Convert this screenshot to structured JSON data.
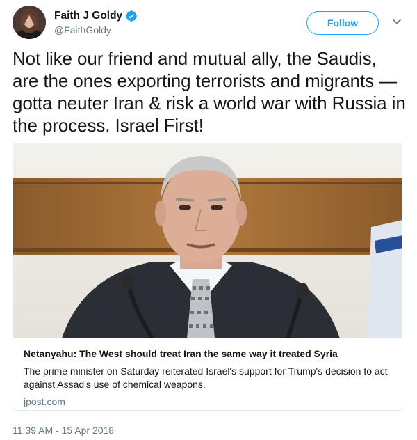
{
  "user": {
    "display_name": "Faith J Goldy",
    "handle": "@FaithGoldy",
    "verified": true
  },
  "follow_label": "Follow",
  "tweet": {
    "text": "Not like our friend and mutual ally, the Saudis, are the ones exporting terrorists and migrants — gotta neuter Iran & risk a world war with Russia in the process. Israel First!"
  },
  "card": {
    "title": "Netanyahu: The West should treat Iran the same way it treated Syria",
    "description": "The prime minister on Saturday reiterated Israel's support for Trump's decision to act against Assad's use of chemical weapons.",
    "domain": "jpost.com"
  },
  "timestamp": "11:39 AM - 15 Apr 2018",
  "colors": {
    "accent": "#1da1f2",
    "secondary_text": "#657786",
    "border": "#e1e8ed"
  },
  "icons": {
    "verified": "verified-badge-icon",
    "caret": "chevron-down-icon"
  }
}
